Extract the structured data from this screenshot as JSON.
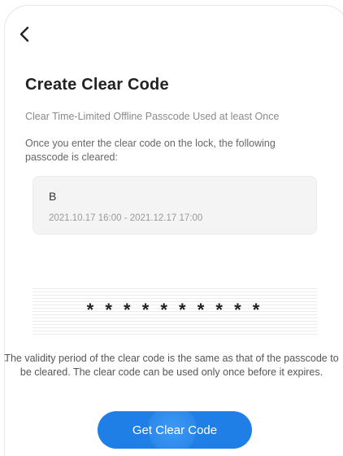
{
  "header": {
    "back_icon": "chevron-left-icon"
  },
  "page": {
    "title": "Create Clear Code",
    "subtitle": "Clear Time-Limited Offline Passcode Used at least Once",
    "description": "Once you enter the clear code on the lock, the following passcode is cleared:"
  },
  "passcode": {
    "name": "B",
    "period": "2021.10.17 16:00 - 2021.12.17 17:00"
  },
  "clear_code": {
    "display": "* * * * * * * * * *"
  },
  "note": {
    "text": "The validity period of the clear code is the same as that of the passcode to be cleared. The clear code can be used only once before it expires."
  },
  "actions": {
    "get_code_label": "Get Clear Code"
  },
  "colors": {
    "accent": "#1f7fe6",
    "card_background": "#f4f4f4"
  }
}
